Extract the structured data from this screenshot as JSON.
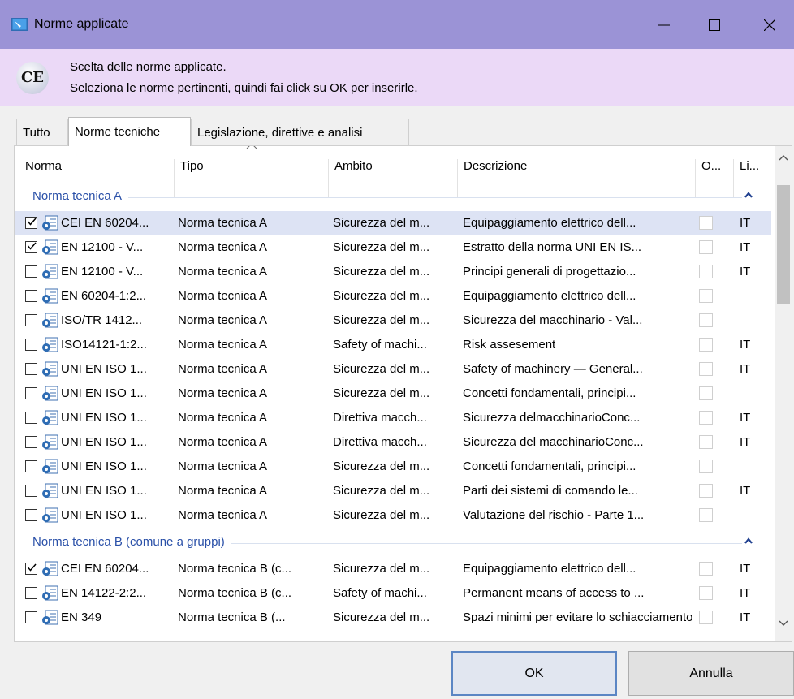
{
  "window": {
    "title": "Norme applicate",
    "minimize": "—",
    "maximize": "☐",
    "close": "✕"
  },
  "header": {
    "badge": "CE",
    "line1": "Scelta delle norme applicate.",
    "line2": "Seleziona le norme pertinenti, quindi fai click su OK per inserirle."
  },
  "tabs": [
    "Tutto",
    "Norme tecniche",
    "Legislazione, direttive e analisi"
  ],
  "active_tab": "Norme tecniche",
  "columns": [
    "Norma",
    "Tipo",
    "Ambito",
    "Descrizione",
    "O...",
    "Li..."
  ],
  "groups": [
    {
      "name": "Norma tecnica A",
      "rows": [
        {
          "checked": true,
          "norma": "CEI EN 60204...",
          "tipo": "Norma tecnica A",
          "ambito": "Sicurezza del m...",
          "descrizione": "Equipaggiamento elettrico dell...",
          "lingua": "IT",
          "selected": true
        },
        {
          "checked": true,
          "norma": "EN 12100 - V...",
          "tipo": "Norma tecnica A",
          "ambito": "Sicurezza del m...",
          "descrizione": "Estratto della norma UNI EN IS...",
          "lingua": "IT"
        },
        {
          "checked": false,
          "norma": "EN 12100 - V...",
          "tipo": "Norma tecnica A",
          "ambito": "Sicurezza del m...",
          "descrizione": "Principi generali di progettazio...",
          "lingua": "IT"
        },
        {
          "checked": false,
          "norma": "EN 60204-1:2...",
          "tipo": "Norma tecnica A",
          "ambito": "Sicurezza del m...",
          "descrizione": "Equipaggiamento elettrico dell...",
          "lingua": ""
        },
        {
          "checked": false,
          "norma": "ISO/TR 1412...",
          "tipo": "Norma tecnica A",
          "ambito": "Sicurezza del m...",
          "descrizione": "Sicurezza del macchinario - Val...",
          "lingua": ""
        },
        {
          "checked": false,
          "norma": "ISO14121-1:2...",
          "tipo": "Norma tecnica A",
          "ambito": "Safety of machi...",
          "descrizione": "Risk assesement",
          "lingua": "IT"
        },
        {
          "checked": false,
          "norma": "UNI EN ISO 1...",
          "tipo": "Norma tecnica A",
          "ambito": "Sicurezza del m...",
          "descrizione": "Safety of machinery — General...",
          "lingua": "IT"
        },
        {
          "checked": false,
          "norma": "UNI EN ISO 1...",
          "tipo": "Norma tecnica A",
          "ambito": "Sicurezza del m...",
          "descrizione": "Concetti fondamentali, principi...",
          "lingua": ""
        },
        {
          "checked": false,
          "norma": "UNI EN ISO 1...",
          "tipo": "Norma tecnica A",
          "ambito": "Direttiva macch...",
          "descrizione": "Sicurezza delmacchinarioConc...",
          "lingua": "IT"
        },
        {
          "checked": false,
          "norma": "UNI EN ISO 1...",
          "tipo": "Norma tecnica A",
          "ambito": "Direttiva macch...",
          "descrizione": "Sicurezza del macchinarioConc...",
          "lingua": "IT"
        },
        {
          "checked": false,
          "norma": "UNI EN ISO 1...",
          "tipo": "Norma tecnica A",
          "ambito": "Sicurezza del m...",
          "descrizione": "Concetti fondamentali, principi...",
          "lingua": ""
        },
        {
          "checked": false,
          "norma": "UNI EN ISO 1...",
          "tipo": "Norma tecnica A",
          "ambito": "Sicurezza del m...",
          "descrizione": "Parti dei sistemi di comando le...",
          "lingua": "IT"
        },
        {
          "checked": false,
          "norma": "UNI EN ISO 1...",
          "tipo": "Norma tecnica A",
          "ambito": "Sicurezza del m...",
          "descrizione": "Valutazione del rischio - Parte 1...",
          "lingua": ""
        }
      ]
    },
    {
      "name": "Norma tecnica B (comune a gruppi)",
      "rows": [
        {
          "checked": true,
          "norma": "CEI EN 60204...",
          "tipo": "Norma tecnica B (c...",
          "ambito": "Sicurezza del m...",
          "descrizione": "Equipaggiamento elettrico dell...",
          "lingua": "IT"
        },
        {
          "checked": false,
          "norma": "EN 14122-2:2...",
          "tipo": "Norma tecnica B (c...",
          "ambito": "Safety of machi...",
          "descrizione": "Permanent means of access to ...",
          "lingua": "IT"
        },
        {
          "checked": false,
          "norma": "EN 349",
          "tipo": "Norma tecnica B (...",
          "ambito": "Sicurezza del m...",
          "descrizione": "Spazi minimi per evitare lo schiacciamento",
          "lingua": "IT"
        }
      ]
    }
  ],
  "buttons": {
    "ok": "OK",
    "cancel": "Annulla"
  },
  "colors": {
    "titlebar": "#9b93d6",
    "header_band": "#ebd9f7",
    "group_text": "#2a50a8",
    "selected_row": "#dde3f4",
    "ok_border": "#5b86c4"
  }
}
